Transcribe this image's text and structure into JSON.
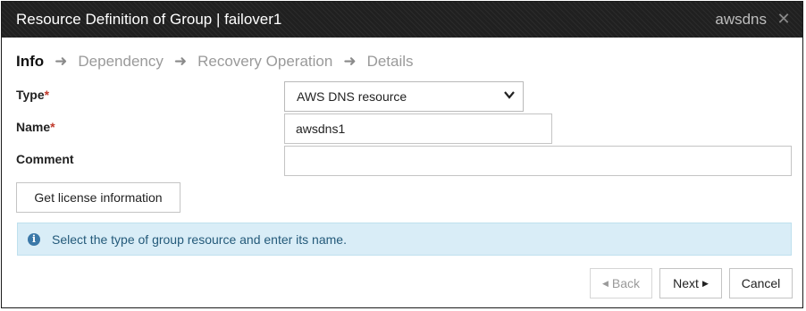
{
  "header": {
    "title": "Resource Definition of Group | failover1",
    "resource_name": "awsdns",
    "close_symbol": "✕"
  },
  "steps": [
    {
      "label": "Info",
      "active": true
    },
    {
      "label": "Dependency",
      "active": false
    },
    {
      "label": "Recovery Operation",
      "active": false
    },
    {
      "label": "Details",
      "active": false
    }
  ],
  "step_arrow": "➜",
  "form": {
    "type_label": "Type",
    "type_value": "AWS DNS resource",
    "name_label": "Name",
    "name_value": "awsdns1",
    "comment_label": "Comment",
    "comment_value": "",
    "required_mark": "*"
  },
  "license_button": "Get license information",
  "alert": {
    "icon": "info-icon",
    "text": "Select the type of group resource and enter its name."
  },
  "footer": {
    "back_label": "Back",
    "next_label": "Next",
    "cancel_label": "Cancel",
    "back_arrow": "◀",
    "next_arrow": "▶"
  },
  "colors": {
    "header_bg": "#202020",
    "alert_bg": "#d9edf7",
    "alert_text": "#245a7a",
    "required": "#c0392b"
  }
}
